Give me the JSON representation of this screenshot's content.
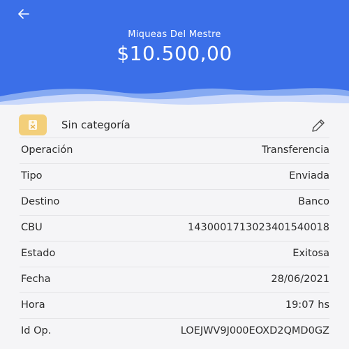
{
  "header": {
    "back_icon": "arrow-left-icon",
    "payee_name": "Miqueas Del Mestre",
    "amount": "$10.500,00",
    "background_color": "#3b6fe8"
  },
  "category": {
    "icon": "tag-icon",
    "label": "Sin categoría",
    "edit_icon": "pencil-icon",
    "badge_color": "#f3cf7a"
  },
  "details": [
    {
      "label": "Operación",
      "value": "Transferencia"
    },
    {
      "label": "Tipo",
      "value": "Enviada"
    },
    {
      "label": "Destino",
      "value": "Banco"
    },
    {
      "label": "CBU",
      "value": "1430001713023401540018"
    },
    {
      "label": "Estado",
      "value": "Exitosa"
    },
    {
      "label": "Fecha",
      "value": "28/06/2021"
    },
    {
      "label": "Hora",
      "value": "19:07 hs"
    },
    {
      "label": "Id Op.",
      "value": "LOEJWV9J000EOXD2QMD0GZ"
    }
  ]
}
